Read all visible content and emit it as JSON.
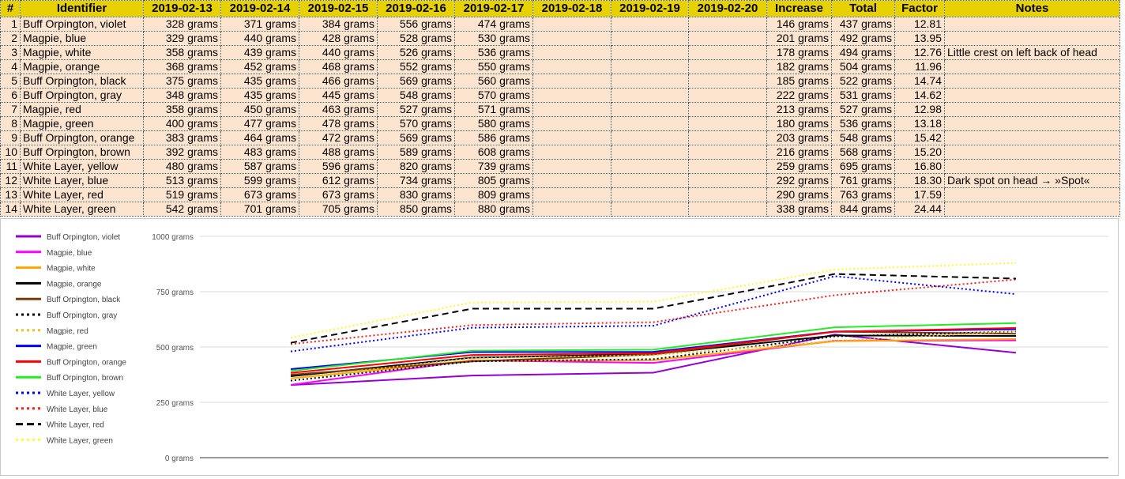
{
  "sheet": {
    "headers": [
      "#",
      "Identifier",
      "2019-02-13",
      "2019-02-14",
      "2019-02-15",
      "2019-02-16",
      "2019-02-17",
      "2019-02-18",
      "2019-02-19",
      "2019-02-20",
      "Increase",
      "Total",
      "Factor",
      "Notes"
    ],
    "rows": [
      [
        "1",
        "Buff Orpington, violet",
        "328 grams",
        "371 grams",
        "384 grams",
        "556 grams",
        "474 grams",
        "",
        "",
        "",
        "146 grams",
        "437 grams",
        "12.81",
        ""
      ],
      [
        "2",
        "Magpie, blue",
        "329 grams",
        "440 grams",
        "428 grams",
        "528 grams",
        "530 grams",
        "",
        "",
        "",
        "201 grams",
        "492 grams",
        "13.95",
        ""
      ],
      [
        "3",
        "Magpie, white",
        "358 grams",
        "439 grams",
        "440 grams",
        "526 grams",
        "536 grams",
        "",
        "",
        "",
        "178 grams",
        "494 grams",
        "12.76",
        "Little crest on left back of head"
      ],
      [
        "4",
        "Magpie, orange",
        "368 grams",
        "452 grams",
        "468 grams",
        "552 grams",
        "550 grams",
        "",
        "",
        "",
        "182 grams",
        "504 grams",
        "11.96",
        ""
      ],
      [
        "5",
        "Buff Orpington, black",
        "375 grams",
        "435 grams",
        "466 grams",
        "569 grams",
        "560 grams",
        "",
        "",
        "",
        "185 grams",
        "522 grams",
        "14.74",
        ""
      ],
      [
        "6",
        "Buff Orpington, gray",
        "348 grams",
        "435 grams",
        "445 grams",
        "548 grams",
        "570 grams",
        "",
        "",
        "",
        "222 grams",
        "531 grams",
        "14.62",
        ""
      ],
      [
        "7",
        "Magpie, red",
        "358 grams",
        "450 grams",
        "463 grams",
        "527 grams",
        "571 grams",
        "",
        "",
        "",
        "213 grams",
        "527 grams",
        "12.98",
        ""
      ],
      [
        "8",
        "Magpie, green",
        "400 grams",
        "477 grams",
        "478 grams",
        "570 grams",
        "580 grams",
        "",
        "",
        "",
        "180 grams",
        "536 grams",
        "13.18",
        ""
      ],
      [
        "9",
        "Buff Orpington, orange",
        "383 grams",
        "464 grams",
        "472 grams",
        "569 grams",
        "586 grams",
        "",
        "",
        "",
        "203 grams",
        "548 grams",
        "15.42",
        ""
      ],
      [
        "10",
        "Buff Orpington, brown",
        "392 grams",
        "483 grams",
        "488 grams",
        "589 grams",
        "608 grams",
        "",
        "",
        "",
        "216 grams",
        "568 grams",
        "15.20",
        ""
      ],
      [
        "11",
        "White Layer, yellow",
        "480 grams",
        "587 grams",
        "596 grams",
        "820 grams",
        "739 grams",
        "",
        "",
        "",
        "259 grams",
        "695 grams",
        "16.80",
        ""
      ],
      [
        "12",
        "White Layer, blue",
        "513 grams",
        "599 grams",
        "612 grams",
        "734 grams",
        "805 grams",
        "",
        "",
        "",
        "292 grams",
        "761 grams",
        "18.30",
        "Dark spot on head → »Spot«"
      ],
      [
        "13",
        "White Layer, red",
        "519 grams",
        "673 grams",
        "673 grams",
        "830 grams",
        "809 grams",
        "",
        "",
        "",
        "290 grams",
        "763 grams",
        "17.59",
        ""
      ],
      [
        "14",
        "White Layer, green",
        "542 grams",
        "701 grams",
        "705 grams",
        "850 grams",
        "880 grams",
        "",
        "",
        "",
        "338 grams",
        "844 grams",
        "24.44",
        ""
      ]
    ]
  },
  "chart_data": {
    "type": "line",
    "x": [
      "2019-02-13",
      "2019-02-14",
      "2019-02-15",
      "2019-02-16",
      "2019-02-17"
    ],
    "ylim": [
      0,
      1000
    ],
    "yticks": [
      "0 grams",
      "250 grams",
      "500 grams",
      "750 grams",
      "1000 grams"
    ],
    "ytick_values": [
      0,
      250,
      500,
      750,
      1000
    ],
    "grid": true,
    "legend": "left",
    "series": [
      {
        "name": "Buff Orpington, violet",
        "color": "#9400d3",
        "style": "solid",
        "values": [
          328,
          371,
          384,
          556,
          474
        ]
      },
      {
        "name": "Magpie, blue",
        "color": "#ff00ff",
        "style": "solid",
        "values": [
          329,
          440,
          428,
          528,
          530
        ]
      },
      {
        "name": "Magpie, white",
        "color": "#ffa500",
        "style": "solid",
        "values": [
          358,
          439,
          440,
          526,
          536
        ]
      },
      {
        "name": "Magpie, orange",
        "color": "#000000",
        "style": "solid",
        "values": [
          368,
          452,
          468,
          552,
          550
        ]
      },
      {
        "name": "Buff Orpington, black",
        "color": "#7a3b0c",
        "style": "solid",
        "values": [
          375,
          435,
          466,
          569,
          560
        ]
      },
      {
        "name": "Buff Orpington, gray",
        "color": "#000000",
        "style": "dotted",
        "values": [
          348,
          435,
          445,
          548,
          570
        ]
      },
      {
        "name": "Magpie, red",
        "color": "#f0c020",
        "style": "dotted",
        "values": [
          358,
          450,
          463,
          527,
          571
        ]
      },
      {
        "name": "Magpie, green",
        "color": "#0000ff",
        "style": "solid",
        "values": [
          400,
          477,
          478,
          570,
          580
        ]
      },
      {
        "name": "Buff Orpington, orange",
        "color": "#ff0000",
        "style": "solid",
        "values": [
          383,
          464,
          472,
          569,
          586
        ]
      },
      {
        "name": "Buff Orpington, brown",
        "color": "#22ee22",
        "style": "solid",
        "values": [
          392,
          483,
          488,
          589,
          608
        ]
      },
      {
        "name": "White Layer, yellow",
        "color": "#0000ff",
        "style": "dotted",
        "values": [
          480,
          587,
          596,
          820,
          739
        ]
      },
      {
        "name": "White Layer, blue",
        "color": "#ee2222",
        "style": "dotted",
        "values": [
          513,
          599,
          612,
          734,
          805
        ]
      },
      {
        "name": "White Layer, red",
        "color": "#000000",
        "style": "dashed",
        "values": [
          519,
          673,
          673,
          830,
          809
        ]
      },
      {
        "name": "White Layer, green",
        "color": "#ffff33",
        "style": "dotted",
        "values": [
          542,
          701,
          705,
          850,
          880
        ]
      }
    ]
  }
}
